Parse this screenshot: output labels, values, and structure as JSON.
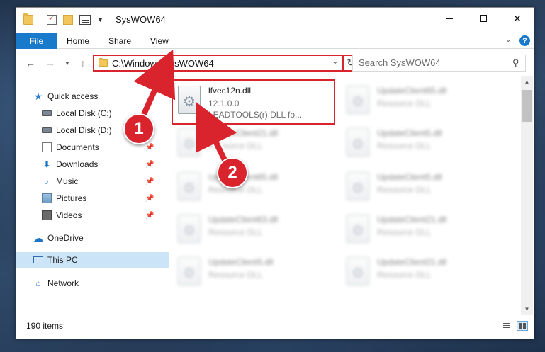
{
  "window": {
    "title": "SysWOW64"
  },
  "ribbon": {
    "tabs": [
      "File",
      "Home",
      "Share",
      "View"
    ],
    "help": "?"
  },
  "address": {
    "path": "C:\\Windows\\SysWOW64",
    "search_placeholder": "Search SysWOW64"
  },
  "sidebar": {
    "items": [
      {
        "label": "Quick access",
        "icon": "star-icon"
      },
      {
        "label": "Local Disk (C:)",
        "icon": "drive-icon"
      },
      {
        "label": "Local Disk (D:)",
        "icon": "drive-icon"
      },
      {
        "label": "Documents",
        "icon": "documents-icon",
        "pinned": true
      },
      {
        "label": "Downloads",
        "icon": "download-icon",
        "pinned": true
      },
      {
        "label": "Music",
        "icon": "music-icon",
        "pinned": true
      },
      {
        "label": "Pictures",
        "icon": "pictures-icon",
        "pinned": true
      },
      {
        "label": "Videos",
        "icon": "videos-icon",
        "pinned": true
      },
      {
        "label": "OneDrive",
        "icon": "cloud-icon"
      },
      {
        "label": "This PC",
        "icon": "computer-icon",
        "selected": true
      },
      {
        "label": "Network",
        "icon": "network-icon"
      }
    ]
  },
  "files": {
    "highlighted": {
      "name": "lfvec12n.dll",
      "version": "12.1.0.0",
      "description": "LEADTOOLS(r) DLL fo..."
    },
    "blurred": [
      {
        "name": "UpdateClient65.dll",
        "type": "Resource DLL"
      },
      {
        "name": "UpdateClient21.dll",
        "type": "Resource DLL"
      },
      {
        "name": "UpdateClient5.dll",
        "type": "Resource DLL"
      },
      {
        "name": "UpdateClient65.dll",
        "type": "Resource DLL"
      },
      {
        "name": "UpdateClient5.dll",
        "type": "Resource DLL"
      },
      {
        "name": "UpdateClient63.dll",
        "type": "Resource DLL"
      },
      {
        "name": "UpdateClient21.dll",
        "type": "Resource DLL"
      },
      {
        "name": "UpdateClient5.dll",
        "type": "Resource DLL"
      },
      {
        "name": "UpdateClient21.dll",
        "type": "Resource DLL"
      }
    ]
  },
  "status": {
    "item_count": "190 items"
  },
  "callouts": [
    "1",
    "2"
  ],
  "colors": {
    "accent": "#1979ca",
    "annotation": "#d9232d",
    "selection": "#cce4f7"
  }
}
